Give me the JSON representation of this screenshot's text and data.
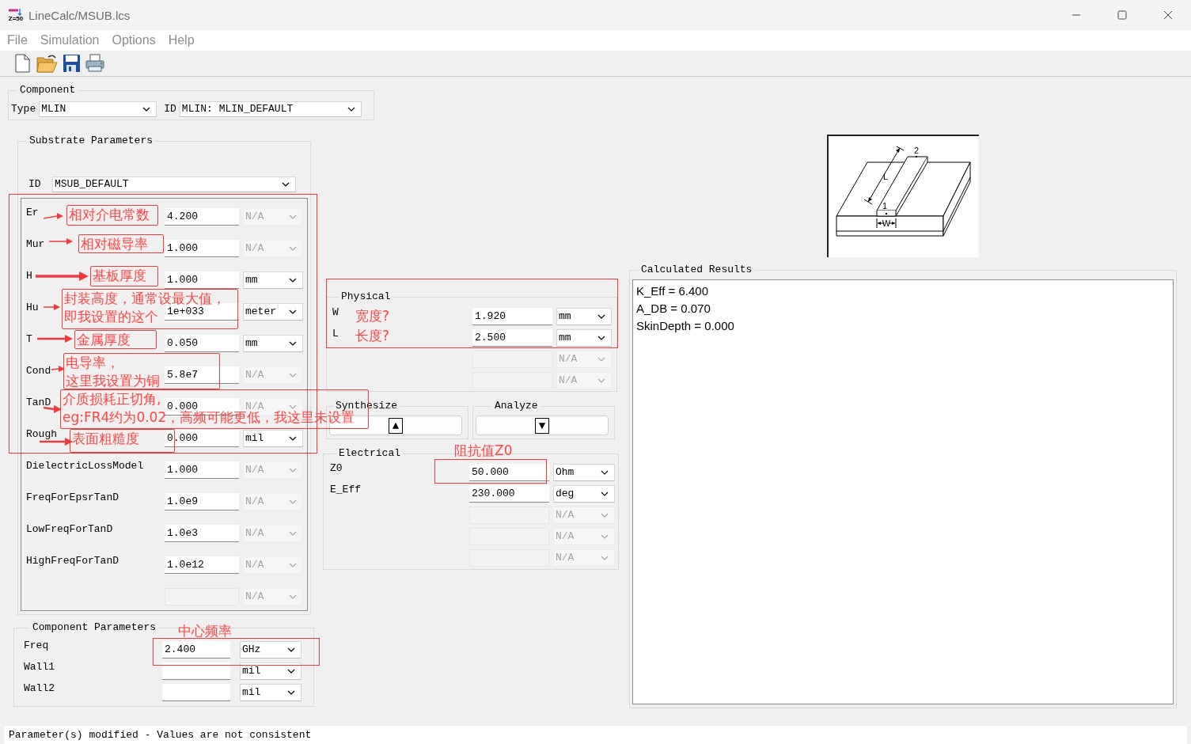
{
  "window": {
    "title": "LineCalc/MSUB.lcs",
    "icon_text": "Z=50"
  },
  "menu": [
    "File",
    "Simulation",
    "Options",
    "Help"
  ],
  "component": {
    "title": "Component",
    "type_label": "Type",
    "type_value": "MLIN",
    "id_label": "ID",
    "id_value": "MLIN: MLIN_DEFAULT"
  },
  "substrate": {
    "title": "Substrate Parameters",
    "id_label": "ID",
    "id_value": "MSUB_DEFAULT",
    "params": [
      {
        "name": "Er",
        "value": "4.200",
        "field_disabled": false,
        "unit": "N/A",
        "unit_disabled": true
      },
      {
        "name": "Mur",
        "value": "1.000",
        "field_disabled": false,
        "unit": "N/A",
        "unit_disabled": true
      },
      {
        "name": "H",
        "value": "1.000",
        "field_disabled": false,
        "unit": "mm",
        "unit_disabled": false
      },
      {
        "name": "Hu",
        "value": "1e+033",
        "field_disabled": false,
        "unit": "meter",
        "unit_disabled": false
      },
      {
        "name": "T",
        "value": "0.050",
        "field_disabled": false,
        "unit": "mm",
        "unit_disabled": false
      },
      {
        "name": "Cond",
        "value": "5.8e7",
        "field_disabled": false,
        "unit": "N/A",
        "unit_disabled": true
      },
      {
        "name": "TanD",
        "value": "0.000",
        "field_disabled": false,
        "unit": "N/A",
        "unit_disabled": true
      },
      {
        "name": "Rough",
        "value": "0.000",
        "field_disabled": false,
        "unit": "mil",
        "unit_disabled": false
      },
      {
        "name": "DielectricLossModel",
        "value": "1.000",
        "field_disabled": false,
        "unit": "N/A",
        "unit_disabled": true
      },
      {
        "name": "FreqForEpsrTanD",
        "value": "1.0e9",
        "field_disabled": false,
        "unit": "N/A",
        "unit_disabled": true
      },
      {
        "name": "LowFreqForTanD",
        "value": "1.0e3",
        "field_disabled": false,
        "unit": "N/A",
        "unit_disabled": true
      },
      {
        "name": "HighFreqForTanD",
        "value": "1.0e12",
        "field_disabled": false,
        "unit": "N/A",
        "unit_disabled": true
      },
      {
        "field_disabled": true,
        "unit": "N/A",
        "unit_disabled": true
      }
    ]
  },
  "component_params": {
    "title": "Component Parameters",
    "params": [
      {
        "name": "Freq",
        "value": "2.400",
        "field_disabled": false,
        "unit": "GHz",
        "unit_disabled": false
      },
      {
        "name": "Wall1",
        "field_disabled": false,
        "unit": "mil",
        "unit_disabled": false
      },
      {
        "name": "Wall2",
        "field_disabled": false,
        "unit": "mil",
        "unit_disabled": false
      }
    ]
  },
  "physical": {
    "title": "Physical",
    "params": [
      {
        "name": "W",
        "value": "1.920",
        "field_disabled": false,
        "unit": "mm",
        "unit_disabled": false
      },
      {
        "name": "L",
        "value": "2.500",
        "field_disabled": false,
        "unit": "mm",
        "unit_disabled": false
      },
      {
        "field_disabled": true,
        "unit": "N/A",
        "unit_disabled": true
      },
      {
        "field_disabled": true,
        "unit": "N/A",
        "unit_disabled": true
      }
    ]
  },
  "synthesize": {
    "title": "Synthesize",
    "glyph": "▲"
  },
  "analyze": {
    "title": "Analyze",
    "glyph": "▼"
  },
  "electrical": {
    "title": "Electrical",
    "params": [
      {
        "name": "Z0",
        "value": "50.000",
        "field_disabled": false,
        "unit": "Ohm",
        "unit_disabled": false
      },
      {
        "name": "E_Eff",
        "value": "230.000",
        "field_disabled": false,
        "unit": "deg",
        "unit_disabled": false
      },
      {
        "field_disabled": true,
        "unit": "N/A",
        "unit_disabled": true
      },
      {
        "field_disabled": true,
        "unit": "N/A",
        "unit_disabled": true
      },
      {
        "field_disabled": true,
        "unit": "N/A",
        "unit_disabled": true
      }
    ]
  },
  "diagram": {
    "labels": [
      "2",
      "L",
      "1",
      "W"
    ]
  },
  "results": {
    "title": "Calculated Results",
    "lines": [
      "K_Eff = 6.400",
      "A_DB = 0.070",
      "SkinDepth = 0.000"
    ]
  },
  "status_bar": "Parameter(s) modified - Values are not consistent",
  "annotations": [
    {
      "lines": [
        "相对介电常数"
      ],
      "boxed": true,
      "arrow": true
    },
    {
      "lines": [
        "相对磁导率"
      ],
      "boxed": true,
      "arrow": true
    },
    {
      "lines": [
        "基板厚度"
      ],
      "boxed": true,
      "arrow": true
    },
    {
      "lines": [
        "封装高度，通常设最大值，",
        "即我设置的这个"
      ],
      "boxed": true,
      "arrow": true
    },
    {
      "lines": [
        "金属厚度"
      ],
      "boxed": true,
      "arrow": true
    },
    {
      "lines": [
        "电导率，",
        "这里我设置为铜"
      ],
      "boxed": true,
      "arrow": true
    },
    {
      "lines": [
        "介质损耗正切角,",
        "eg:FR4约为0.02，高频可能更低，我这里未设置"
      ],
      "boxed": true,
      "arrow": true
    },
    {
      "lines": [
        "表面粗糙度"
      ],
      "boxed": true,
      "arrow": true
    },
    {
      "lines": [
        "宽度?"
      ],
      "boxed": false,
      "arrow": false
    },
    {
      "lines": [
        "长度?"
      ],
      "boxed": false,
      "arrow": false
    },
    {
      "lines": [
        "阻抗值Z0"
      ],
      "boxed": false,
      "arrow": false
    },
    {
      "lines": [
        "中心频率"
      ],
      "boxed": false,
      "arrow": false
    }
  ]
}
